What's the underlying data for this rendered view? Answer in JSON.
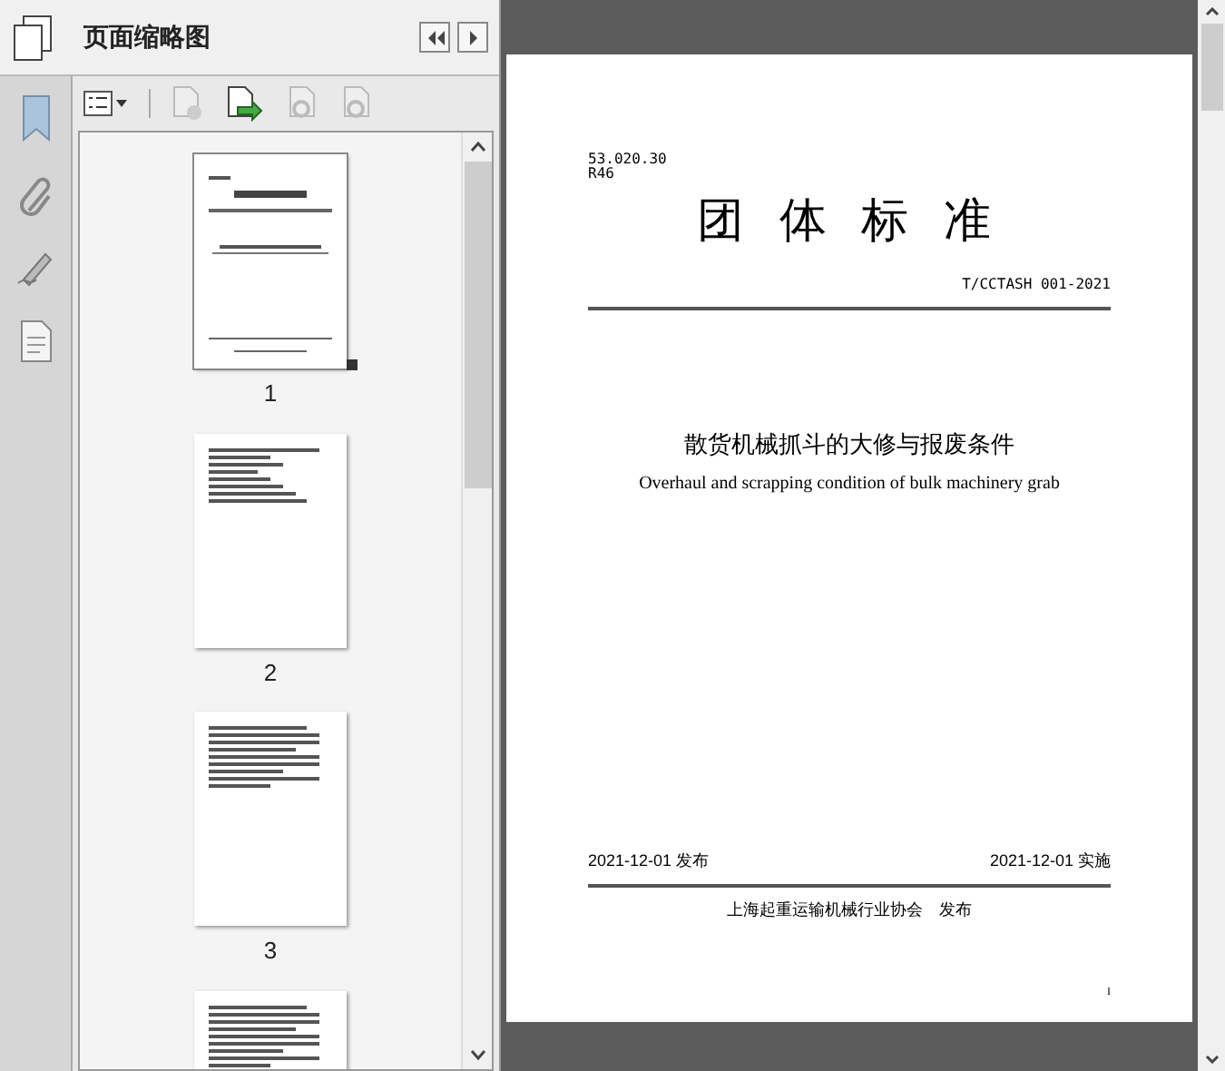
{
  "panel": {
    "title": "页面缩略图"
  },
  "thumbnails": [
    {
      "label": "1",
      "selected": true,
      "kind": "cover"
    },
    {
      "label": "2",
      "selected": false,
      "kind": "contents"
    },
    {
      "label": "3",
      "selected": false,
      "kind": "text"
    },
    {
      "selected": false,
      "kind": "text"
    }
  ],
  "document": {
    "classification": "53.020.30",
    "code": "R46",
    "heading": "团 体 标 准",
    "standard_number": "T/CCTASH 001-2021",
    "title_zh": "散货机械抓斗的大修与报废条件",
    "title_en": "Overhaul and scrapping condition of bulk machinery grab",
    "issue_date": "2021-12-01 发布",
    "effective_date": "2021-12-01 实施",
    "publisher": "上海起重运输机械行业协会　发布",
    "page_number": "I"
  }
}
